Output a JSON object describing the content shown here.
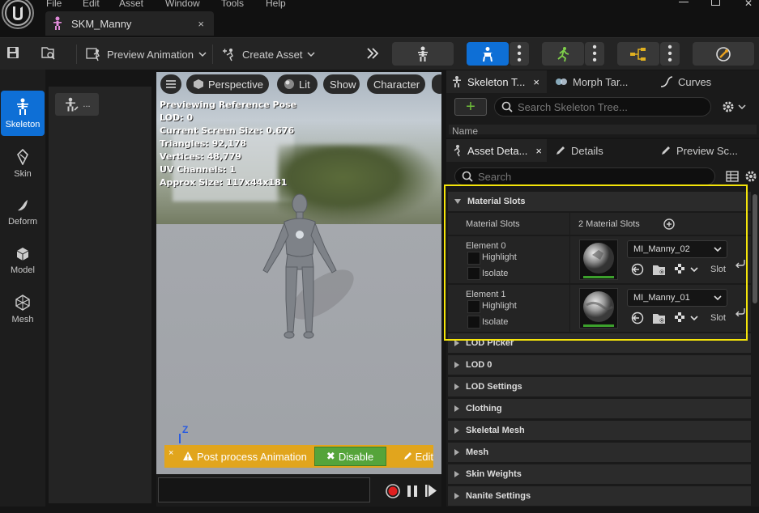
{
  "menu": [
    "File",
    "Edit",
    "Asset",
    "Window",
    "Tools",
    "Help"
  ],
  "document_tab": {
    "title": "SKM_Manny",
    "close": "×"
  },
  "toolbar": {
    "preview_animation": "Preview Animation",
    "create_asset": "Create Asset"
  },
  "left_rail": [
    {
      "label": "Skeleton",
      "icon": "skeleton-icon",
      "active": true
    },
    {
      "label": "Skin",
      "icon": "skin-icon"
    },
    {
      "label": "Deform",
      "icon": "deform-icon"
    },
    {
      "label": "Model",
      "icon": "model-icon"
    },
    {
      "label": "Mesh",
      "icon": "mesh-icon"
    }
  ],
  "left_panel": {
    "button_label": "..."
  },
  "viewport": {
    "perspective": "Perspective",
    "lit": "Lit",
    "show": "Show",
    "character": "Character",
    "stats": [
      "Previewing Reference Pose",
      "LOD: 0",
      "Current Screen Size: 0.676",
      "Triangles: 92,178",
      "Vertices: 48,779",
      "UV Channels: 1",
      "Approx Size: 117x44x181"
    ],
    "axis_label": "Z",
    "post_process": {
      "close": "×",
      "text": "Post process Animation",
      "disable": "Disable",
      "edit": "Edit"
    }
  },
  "right_top": {
    "tabs": [
      "Skeleton T...",
      "Morph Tar...",
      "Curves"
    ],
    "search_placeholder": "Search Skeleton Tree...",
    "column_header": "Name"
  },
  "details": {
    "tabs": [
      "Asset Deta...",
      "Details",
      "Preview Sc..."
    ],
    "search_placeholder": "Search",
    "material_slots": {
      "header": "Material Slots",
      "label": "Material Slots",
      "count": "2 Material Slots",
      "elements": [
        {
          "name": "Element 0",
          "highlight": "Highlight",
          "isolate": "Isolate",
          "material": "MI_Manny_02",
          "slot": "Slot"
        },
        {
          "name": "Element 1",
          "highlight": "Highlight",
          "isolate": "Isolate",
          "material": "MI_Manny_01",
          "slot": "Slot"
        }
      ]
    },
    "categories": [
      "LOD Picker",
      "LOD 0",
      "LOD Settings",
      "Clothing",
      "Skeletal Mesh",
      "Mesh",
      "Skin Weights",
      "Nanite Settings"
    ]
  },
  "colors": {
    "accent_blue": "#0e6fd6",
    "warning_bar": "#e1a51d",
    "disable_green": "#55a43a",
    "highlight_yellow": "#f5e50a"
  }
}
